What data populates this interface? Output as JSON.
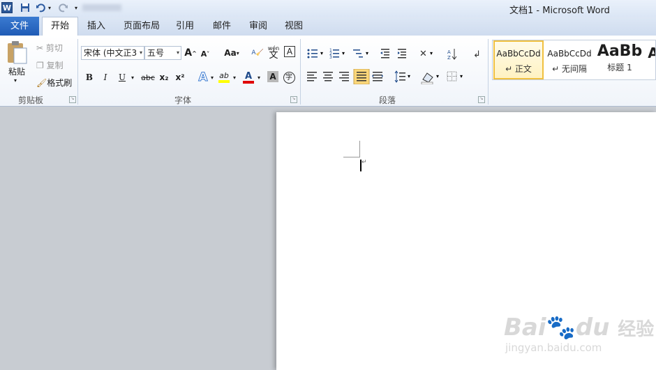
{
  "window": {
    "title": "文档1 - Microsoft Word"
  },
  "qat": {
    "app_icon": "W",
    "save_icon": "save-icon",
    "undo_icon": "undo-icon",
    "redo_icon": "redo-icon"
  },
  "tabs": [
    {
      "label": "文件"
    },
    {
      "label": "开始"
    },
    {
      "label": "插入"
    },
    {
      "label": "页面布局"
    },
    {
      "label": "引用"
    },
    {
      "label": "邮件"
    },
    {
      "label": "审阅"
    },
    {
      "label": "视图"
    }
  ],
  "clipboard": {
    "paste_label": "粘贴",
    "cut_label": "剪切",
    "copy_label": "复制",
    "format_painter_label": "格式刷",
    "group_label": "剪贴板"
  },
  "font": {
    "font_name": "宋体 (中文正3",
    "font_size": "五号",
    "grow": "A",
    "shrink": "A",
    "change_case": "Aa",
    "bold": "B",
    "italic": "I",
    "underline": "U",
    "strikethrough": "abc",
    "subscript": "x₂",
    "superscript": "x²",
    "text_effect": "A",
    "highlight": "ab",
    "font_color": "A",
    "char_shading": "A",
    "enclose": "字",
    "phonetic": "wén",
    "phonetic_char": "文",
    "char_border": "A",
    "group_label": "字体"
  },
  "paragraph": {
    "group_label": "段落"
  },
  "styles": [
    {
      "sample": "AaBbCcDd",
      "name": "↵ 正文"
    },
    {
      "sample": "AaBbCcDd",
      "name": "↵ 无间隔"
    },
    {
      "sample": "AaBb",
      "name": "标题 1"
    },
    {
      "sample": "A",
      "name": ""
    }
  ],
  "watermark": {
    "brand": "Bai",
    "brand2": "du",
    "cn": "经验",
    "url": "jingyan.baidu.com"
  },
  "colors": {
    "file_tab": "#2a6acb",
    "highlight": "#ffff00",
    "font_color": "#e00000",
    "selected_style_border": "#f0c040"
  }
}
